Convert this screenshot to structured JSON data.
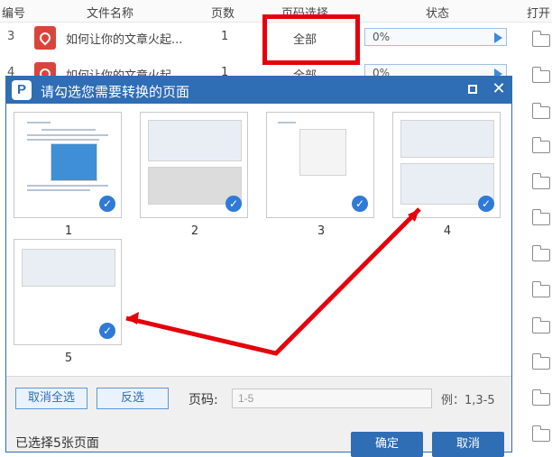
{
  "table": {
    "headers": {
      "num": "编号",
      "name": "文件名称",
      "pages": "页数",
      "page_select": "页码选择",
      "status": "状态",
      "open": "打开"
    },
    "rows": [
      {
        "num": "3",
        "name": "如何让你的文章火起...",
        "pages": "1",
        "page_select": "全部",
        "progress": "0%"
      },
      {
        "num": "4",
        "name": "如何让你的文章火起...",
        "pages": "1",
        "page_select": "全部",
        "progress": "0%"
      }
    ]
  },
  "dialog": {
    "title": "请勾选您需要转换的页面",
    "logo": "P",
    "pages": [
      {
        "label": "1",
        "checked": true
      },
      {
        "label": "2",
        "checked": true
      },
      {
        "label": "3",
        "checked": true
      },
      {
        "label": "4",
        "checked": true
      },
      {
        "label": "5",
        "checked": true
      }
    ],
    "deselect_all": "取消全选",
    "invert": "反选",
    "page_range_label": "页码:",
    "page_range_placeholder": "1-5",
    "example": "例：1,3-5",
    "selected_count": "已选择5张页面",
    "ok": "确定",
    "cancel": "取消"
  },
  "colors": {
    "accent": "#2f6db4",
    "annotation": "#e5000a"
  },
  "icons": {
    "pdf": "pdf-file-icon",
    "folder": "folder-icon",
    "check": "check-circle-icon",
    "play": "play-icon"
  }
}
